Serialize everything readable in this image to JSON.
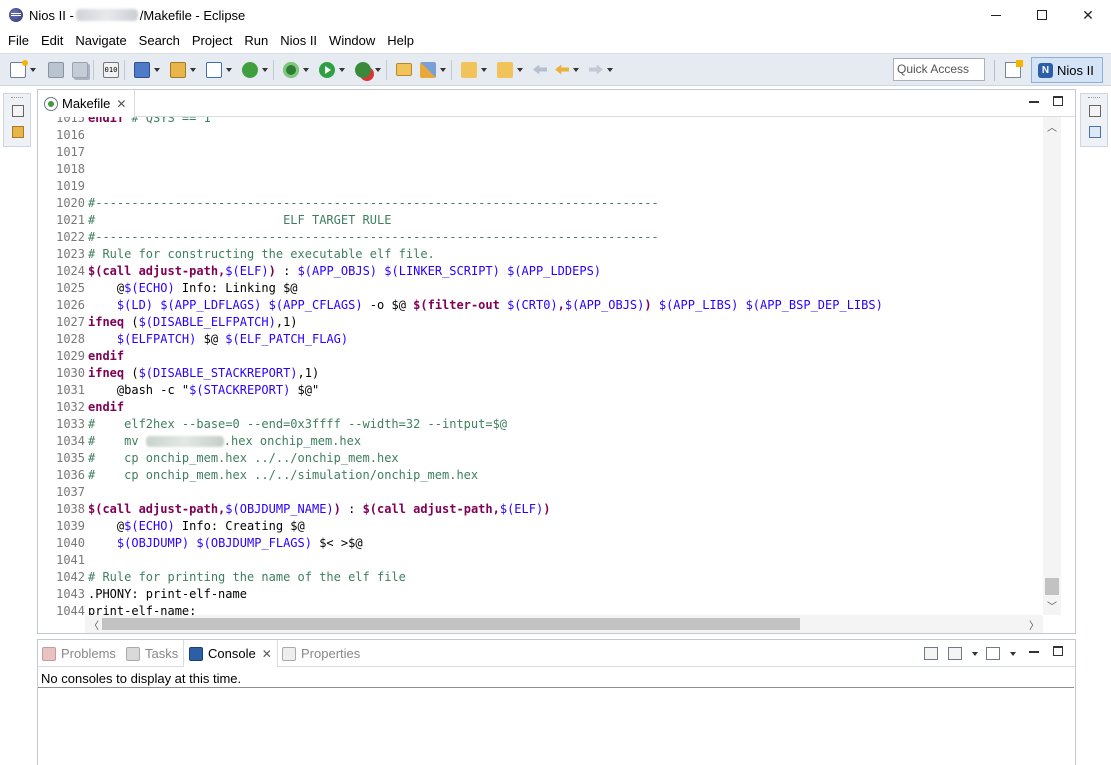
{
  "window": {
    "title_prefix": "Nios II - ",
    "title_suffix": "/Makefile - Eclipse"
  },
  "menu": [
    "File",
    "Edit",
    "Navigate",
    "Search",
    "Project",
    "Run",
    "Nios II",
    "Window",
    "Help"
  ],
  "toolbar": {
    "quick_access_placeholder": "Quick Access",
    "perspective_label": "Nios II",
    "perspective_icon_text": "N",
    "binary_icon_text": "010"
  },
  "editor": {
    "tab_label": "Makefile",
    "lines": [
      {
        "n": "1015",
        "s": [
          [
            "kw",
            "endif"
          ],
          [
            "cm",
            " # QSYS == 1"
          ]
        ]
      },
      {
        "n": "1016",
        "s": []
      },
      {
        "n": "1017",
        "s": []
      },
      {
        "n": "1018",
        "s": []
      },
      {
        "n": "1019",
        "s": []
      },
      {
        "n": "1020",
        "s": [
          [
            "cm",
            "#------------------------------------------------------------------------------"
          ]
        ]
      },
      {
        "n": "1021",
        "s": [
          [
            "cm",
            "#                          ELF TARGET RULE"
          ]
        ]
      },
      {
        "n": "1022",
        "s": [
          [
            "cm",
            "#------------------------------------------------------------------------------"
          ]
        ]
      },
      {
        "n": "1023",
        "s": [
          [
            "cm",
            "# Rule for constructing the executable elf file."
          ]
        ]
      },
      {
        "n": "1024",
        "s": [
          [
            "kw",
            "$(call adjust-path,"
          ],
          [
            "var",
            "$(ELF)"
          ],
          [
            "kw",
            ")"
          ],
          [
            "p",
            " : "
          ],
          [
            "var",
            "$(APP_OBJS)"
          ],
          [
            "p",
            " "
          ],
          [
            "var",
            "$(LINKER_SCRIPT)"
          ],
          [
            "p",
            " "
          ],
          [
            "var",
            "$(APP_LDDEPS)"
          ]
        ]
      },
      {
        "n": "1025",
        "s": [
          [
            "p",
            "    @"
          ],
          [
            "var",
            "$(ECHO)"
          ],
          [
            "p",
            " Info: Linking $@"
          ]
        ]
      },
      {
        "n": "1026",
        "s": [
          [
            "p",
            "    "
          ],
          [
            "var",
            "$(LD)"
          ],
          [
            "p",
            " "
          ],
          [
            "var",
            "$(APP_LDFLAGS)"
          ],
          [
            "p",
            " "
          ],
          [
            "var",
            "$(APP_CFLAGS)"
          ],
          [
            "p",
            " -o $@ "
          ],
          [
            "kw",
            "$(filter-out "
          ],
          [
            "var",
            "$(CRT0)"
          ],
          [
            "kw",
            ","
          ],
          [
            "var",
            "$(APP_OBJS)"
          ],
          [
            "kw",
            ")"
          ],
          [
            "p",
            " "
          ],
          [
            "var",
            "$(APP_LIBS)"
          ],
          [
            "p",
            " "
          ],
          [
            "var",
            "$(APP_BSP_DEP_LIBS)"
          ]
        ]
      },
      {
        "n": "1027",
        "s": [
          [
            "kw",
            "ifneq"
          ],
          [
            "p",
            " ("
          ],
          [
            "var",
            "$(DISABLE_ELFPATCH)"
          ],
          [
            "p",
            ",1)"
          ]
        ]
      },
      {
        "n": "1028",
        "s": [
          [
            "p",
            "    "
          ],
          [
            "var",
            "$(ELFPATCH)"
          ],
          [
            "p",
            " $@ "
          ],
          [
            "var",
            "$(ELF_PATCH_FLAG)"
          ]
        ]
      },
      {
        "n": "1029",
        "s": [
          [
            "kw",
            "endif"
          ]
        ]
      },
      {
        "n": "1030",
        "s": [
          [
            "kw",
            "ifneq"
          ],
          [
            "p",
            " ("
          ],
          [
            "var",
            "$(DISABLE_STACKREPORT)"
          ],
          [
            "p",
            ",1)"
          ]
        ]
      },
      {
        "n": "1031",
        "s": [
          [
            "p",
            "    @bash -c \""
          ],
          [
            "var",
            "$(STACKREPORT)"
          ],
          [
            "p",
            " $@\""
          ]
        ]
      },
      {
        "n": "1032",
        "s": [
          [
            "kw",
            "endif"
          ]
        ]
      },
      {
        "n": "1033",
        "s": [
          [
            "cm",
            "#    elf2hex --base=0 --end=0x3ffff --width=32 --intput=$@"
          ]
        ]
      },
      {
        "n": "1034",
        "s": [
          [
            "cm",
            "#    mv "
          ],
          [
            "blur",
            ""
          ],
          [
            "cm",
            ".hex onchip_mem.hex"
          ]
        ]
      },
      {
        "n": "1035",
        "s": [
          [
            "cm",
            "#    cp onchip_mem.hex ../../onchip_mem.hex"
          ]
        ]
      },
      {
        "n": "1036",
        "s": [
          [
            "cm",
            "#    cp onchip_mem.hex ../../simulation/onchip_mem.hex"
          ]
        ]
      },
      {
        "n": "1037",
        "s": []
      },
      {
        "n": "1038",
        "s": [
          [
            "kw",
            "$(call adjust-path,"
          ],
          [
            "var",
            "$(OBJDUMP_NAME)"
          ],
          [
            "kw",
            ")"
          ],
          [
            "p",
            " : "
          ],
          [
            "kw",
            "$(call adjust-path,"
          ],
          [
            "var",
            "$(ELF)"
          ],
          [
            "kw",
            ")"
          ]
        ]
      },
      {
        "n": "1039",
        "s": [
          [
            "p",
            "    @"
          ],
          [
            "var",
            "$(ECHO)"
          ],
          [
            "p",
            " Info: Creating $@"
          ]
        ]
      },
      {
        "n": "1040",
        "s": [
          [
            "p",
            "    "
          ],
          [
            "var",
            "$(OBJDUMP)"
          ],
          [
            "p",
            " "
          ],
          [
            "var",
            "$(OBJDUMP_FLAGS)"
          ],
          [
            "p",
            " $< >$@"
          ]
        ]
      },
      {
        "n": "1041",
        "s": []
      },
      {
        "n": "1042",
        "s": [
          [
            "cm",
            "# Rule for printing the name of the elf file"
          ]
        ]
      },
      {
        "n": "1043",
        "s": [
          [
            "p",
            ".PHONY: print-elf-name"
          ]
        ]
      },
      {
        "n": "1044",
        "s": [
          [
            "p",
            "print-elf-name:"
          ]
        ]
      }
    ]
  },
  "bottom": {
    "tabs": [
      {
        "label": "Problems",
        "icon": "problems-icon",
        "active": false
      },
      {
        "label": "Tasks",
        "icon": "tasks-icon",
        "active": false
      },
      {
        "label": "Console",
        "icon": "console-icon",
        "active": true
      },
      {
        "label": "Properties",
        "icon": "properties-icon",
        "active": false
      }
    ],
    "console_message": "No consoles to display at this time."
  }
}
